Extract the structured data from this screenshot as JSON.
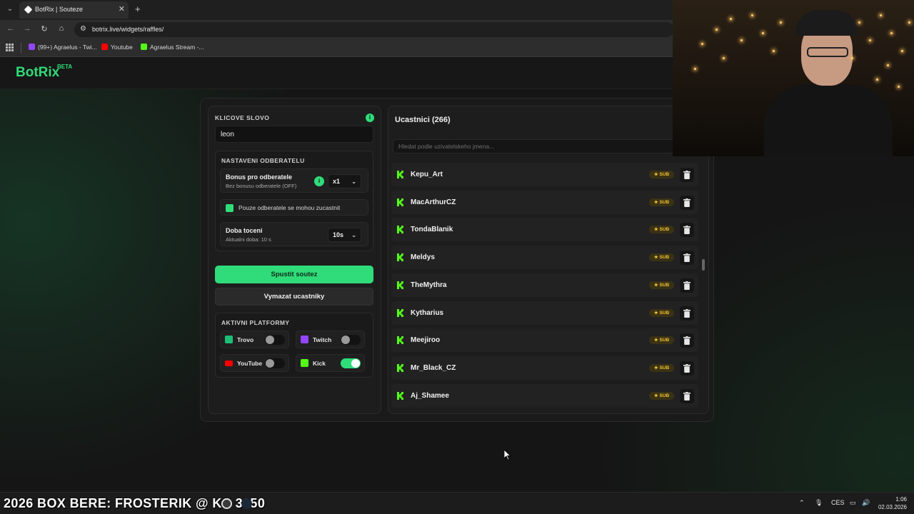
{
  "browser": {
    "tab_title": "BotRix | Souteze",
    "tab_close": "✕",
    "new_tab": "+",
    "url": "botrix.live/widgets/raffles/",
    "bookmarks": [
      {
        "label": "(99+) Agraelus - Twi...",
        "color": "#9146ff"
      },
      {
        "label": "Youtube",
        "color": "#ff0000"
      },
      {
        "label": "Agraelus Stream -...",
        "color": "#53fc18"
      }
    ]
  },
  "header": {
    "logo": "BotRix",
    "beta": "BETA"
  },
  "left": {
    "keyword_label": "KLICOVE SLOVO",
    "keyword_value": "leon",
    "sub_settings_title": "NASTAVENI ODBERATELU",
    "bonus_title": "Bonus pro odberatele",
    "bonus_sub": "Bez bonusu odberatele (OFF)",
    "bonus_value": "x1",
    "subs_only_label": "Pouze odberatele se mohou zucastnit",
    "spin_title": "Doba toceni",
    "spin_sub": "Aktualni doba: 10 s",
    "spin_value": "10s",
    "start_button": "Spustit soutez",
    "clear_button": "Vymazat ucastniky",
    "platforms_title": "AKTIVNI PLATFORMY",
    "platforms": [
      {
        "name": "Trovo",
        "enabled": false,
        "color": "#1bbf75"
      },
      {
        "name": "Twitch",
        "enabled": false,
        "color": "#9146ff"
      },
      {
        "name": "YouTube",
        "enabled": false,
        "color": "#ff0000"
      },
      {
        "name": "Kick",
        "enabled": true,
        "color": "#53fc18"
      }
    ]
  },
  "right": {
    "title": "Ucastnici (266)",
    "search_placeholder": "Hledat podle uzivatelskeho jmena...",
    "sub_badge": "★ SUB",
    "participants": [
      "Kepu_Art",
      "MacArthurCZ",
      "TondaBlanik",
      "Meldys",
      "TheMythra",
      "Kytharius",
      "Meejiroo",
      "Mr_Black_CZ",
      "Aj_Shamee"
    ]
  },
  "taskbar": {
    "ticker": "2026 BOX BERE: FROSTERIK @ KC 3350",
    "lang": "CES",
    "time": "1:06",
    "date": "02.03.2026"
  },
  "colors": {
    "accent": "#2fdc79",
    "kick": "#53fc18",
    "badge": "#f1c232"
  }
}
